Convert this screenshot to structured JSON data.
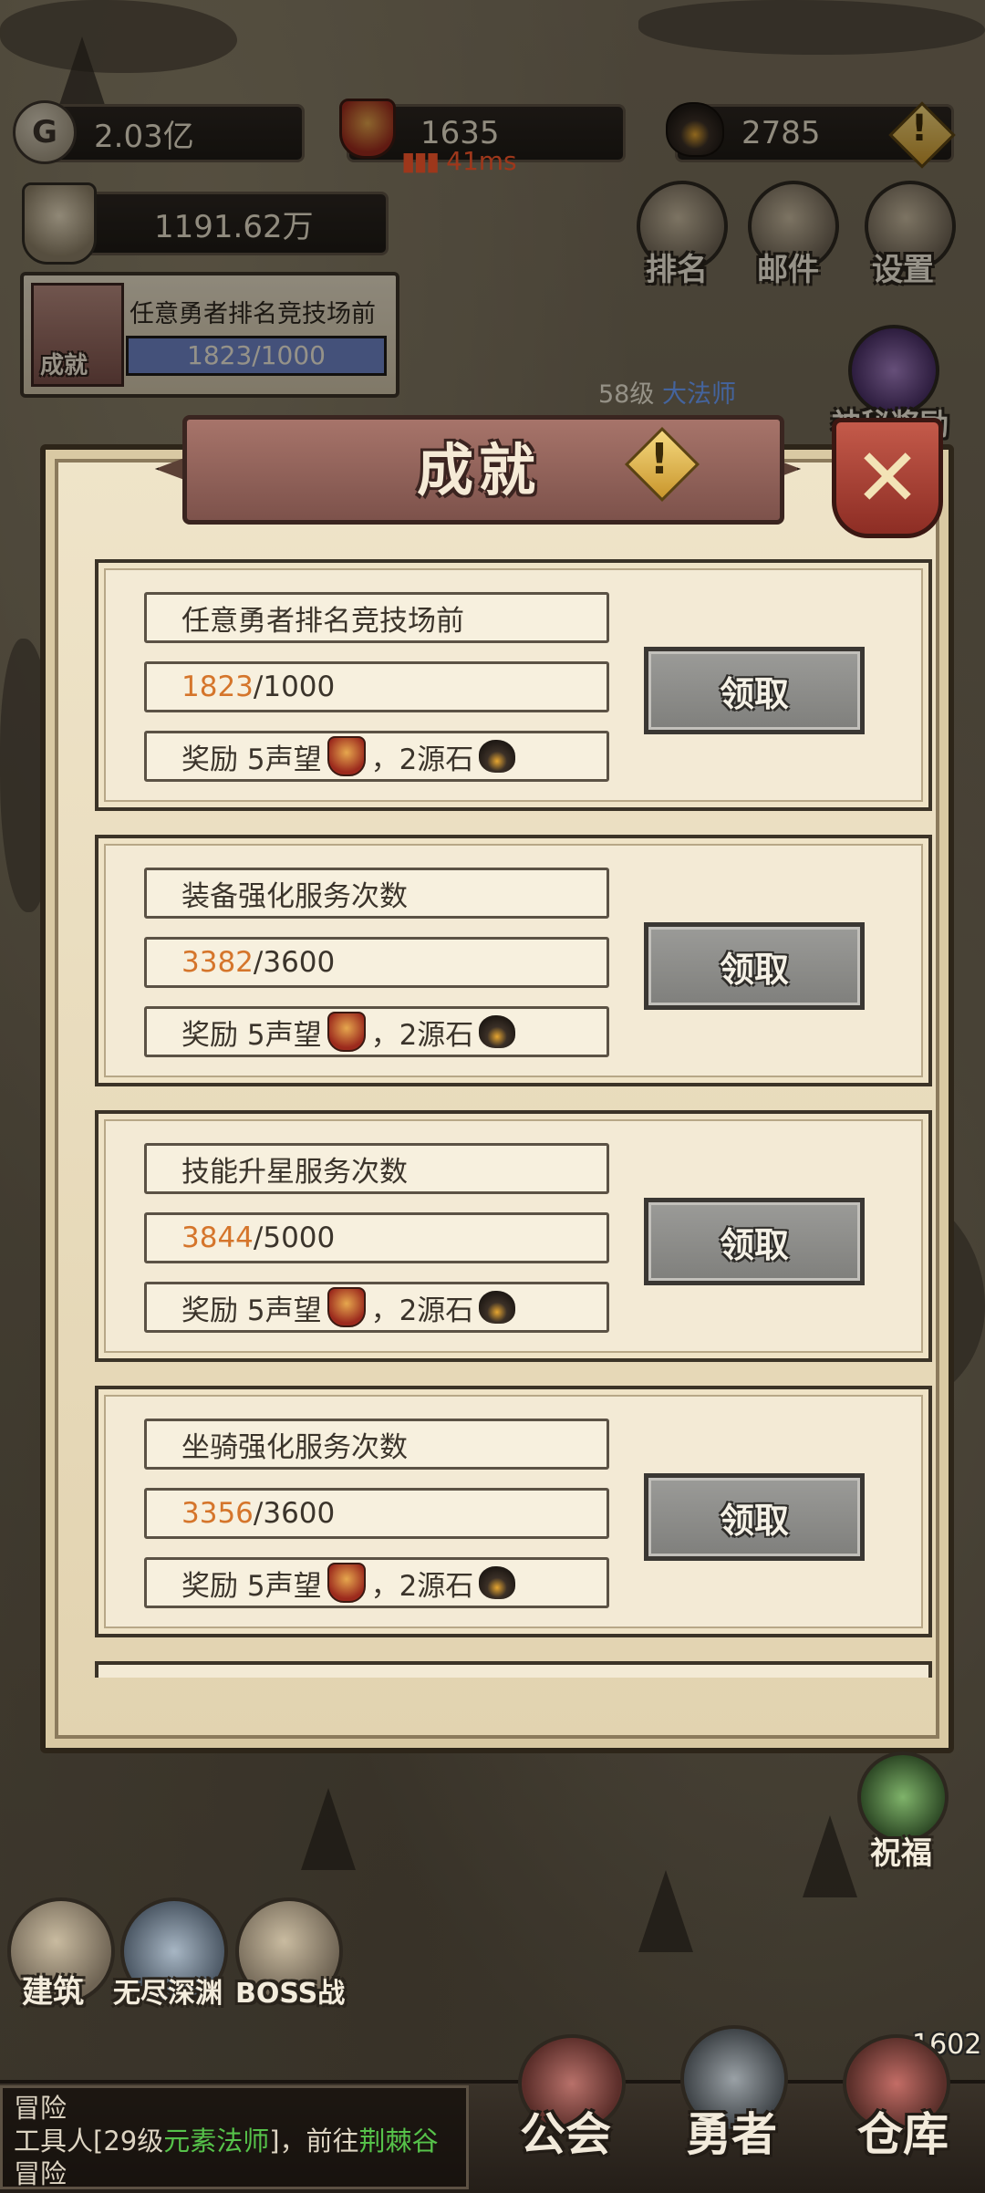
{
  "resources": {
    "gold": "2.03亿",
    "reputation": "1635",
    "ping": "41ms",
    "source_stone": "2785",
    "power": "1191.62万"
  },
  "top_buttons": {
    "ranking": "排名",
    "mail": "邮件",
    "settings": "设置"
  },
  "mini_achievement": {
    "icon_label": "成就",
    "title": "任意勇者排名竞技场前",
    "progress": "1823/1000"
  },
  "map_labels": {
    "npc_level": "58级",
    "npc_class": "大法师",
    "mystery_reward": "神秘奖励",
    "blessing": "祝福",
    "count_1602": "1602"
  },
  "dialog": {
    "title": "成就",
    "close_symbol": "✕",
    "achievements": [
      {
        "name": "任意勇者排名竞技场前",
        "current": "1823",
        "target": "/1000",
        "reward_prefix": "奖励 5声望",
        "reward_suffix": "，2源石",
        "button": "领取"
      },
      {
        "name": "装备强化服务次数",
        "current": "3382",
        "target": "/3600",
        "reward_prefix": "奖励 5声望",
        "reward_suffix": "，2源石",
        "button": "领取"
      },
      {
        "name": "技能升星服务次数",
        "current": "3844",
        "target": "/5000",
        "reward_prefix": "奖励 5声望",
        "reward_suffix": "，2源石",
        "button": "领取"
      },
      {
        "name": "坐骑强化服务次数",
        "current": "3356",
        "target": "/3600",
        "reward_prefix": "奖励 5声望",
        "reward_suffix": "，2源石",
        "button": "领取"
      }
    ]
  },
  "side_buttons": {
    "build": "建筑",
    "abyss": "无尽深渊",
    "boss": "BOSS战"
  },
  "chat": {
    "channel": "冒险",
    "line1_prefix": "工具人[29级",
    "line1_class": "元素法师",
    "line1_mid": "]，前往",
    "line1_place": "荆棘谷",
    "line2": "冒险"
  },
  "nav": {
    "guild": "公会",
    "hero": "勇者",
    "warehouse": "仓库"
  }
}
